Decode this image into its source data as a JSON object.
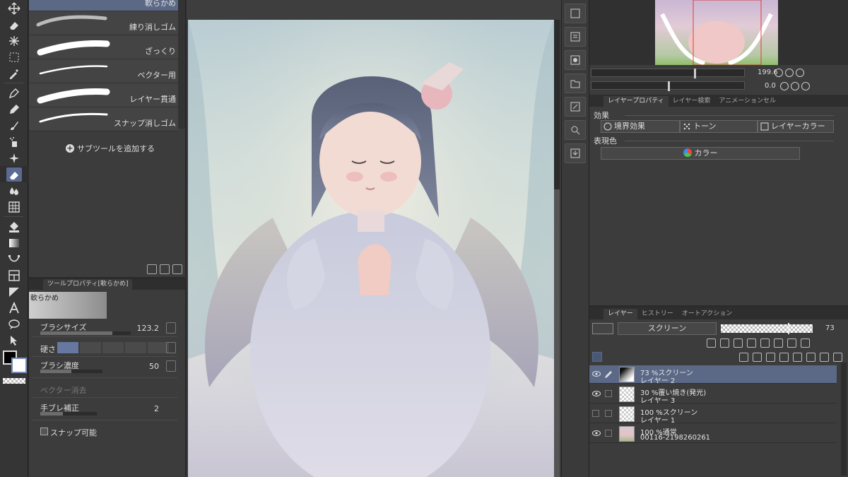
{
  "subtool": {
    "brushes": [
      {
        "label": "軟らかめ",
        "selected": true
      },
      {
        "label": "練り消しゴム",
        "selected": false
      },
      {
        "label": "ざっくり",
        "selected": false
      },
      {
        "label": "ベクター用",
        "selected": false
      },
      {
        "label": "レイヤー貫通",
        "selected": false
      },
      {
        "label": "スナップ消しゴム",
        "selected": false
      }
    ],
    "add_label": "サブツールを追加する"
  },
  "tool_property": {
    "tab_label": "ツールプロパティ[軟らかめ]",
    "preview_label": "軟らかめ",
    "brush_size_label": "ブラシサイズ",
    "brush_size_value": "123.2",
    "hardness_label": "硬さ",
    "density_label": "ブラシ濃度",
    "density_value": "50",
    "vector_erase_label": "ベクター消去",
    "stabilization_label": "手ブレ補正",
    "stabilization_value": "2",
    "snap_label": "スナップ可能"
  },
  "navigator": {
    "zoom_value": "199.6",
    "rotate_value": "0.0"
  },
  "layer_property": {
    "tabs": [
      "レイヤープロパティ",
      "レイヤー検索",
      "アニメーションセル"
    ],
    "effect_label": "効果",
    "effects": [
      "境界効果",
      "トーン",
      "レイヤーカラー"
    ],
    "expression_label": "表現色",
    "expression_value": "カラー"
  },
  "layer_panel": {
    "tabs": [
      "レイヤー",
      "ヒストリー",
      "オートアクション"
    ],
    "blend_mode": "スクリーン",
    "opacity": "73",
    "opacity_fraction": 0.73,
    "layers": [
      {
        "line1": "73 %スクリーン",
        "line2": "レイヤー 2",
        "selected": true,
        "visible": true
      },
      {
        "line1": "30 %覆い焼き(発光)",
        "line2": "レイヤー 3",
        "selected": false,
        "visible": true
      },
      {
        "line1": "100 %スクリーン",
        "line2": "レイヤー 1",
        "selected": false,
        "visible": false
      },
      {
        "line1": "100 %通常",
        "line2": "00116-2198260261",
        "selected": false,
        "visible": true
      }
    ]
  },
  "colors": {
    "accent": "#5b6987",
    "panel": "#3c3c3c",
    "foreground": "#000000",
    "background": "#ffffff"
  }
}
